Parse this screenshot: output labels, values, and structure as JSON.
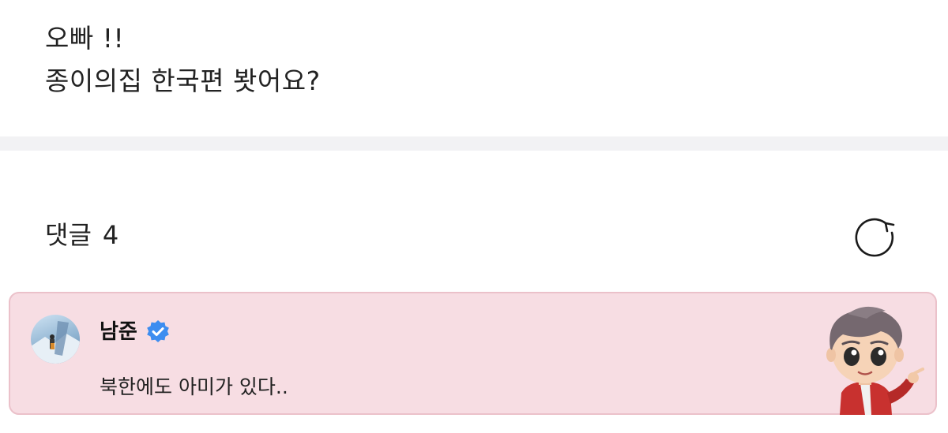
{
  "post": {
    "lines": [
      "오빠 !!",
      "종이의집 한국편 봣어요?"
    ]
  },
  "comments": {
    "title": "댓글",
    "count": "4"
  },
  "comment": {
    "author": "남준",
    "text": "북한에도 아미가 있다.."
  },
  "icons": {
    "refresh": "refresh-icon",
    "verified": "verified-badge-icon"
  },
  "colors": {
    "comment_background": "#f7dde3",
    "comment_border": "#ebc1ca",
    "verified_badge": "#3d8df0",
    "divider": "#f2f2f4"
  }
}
